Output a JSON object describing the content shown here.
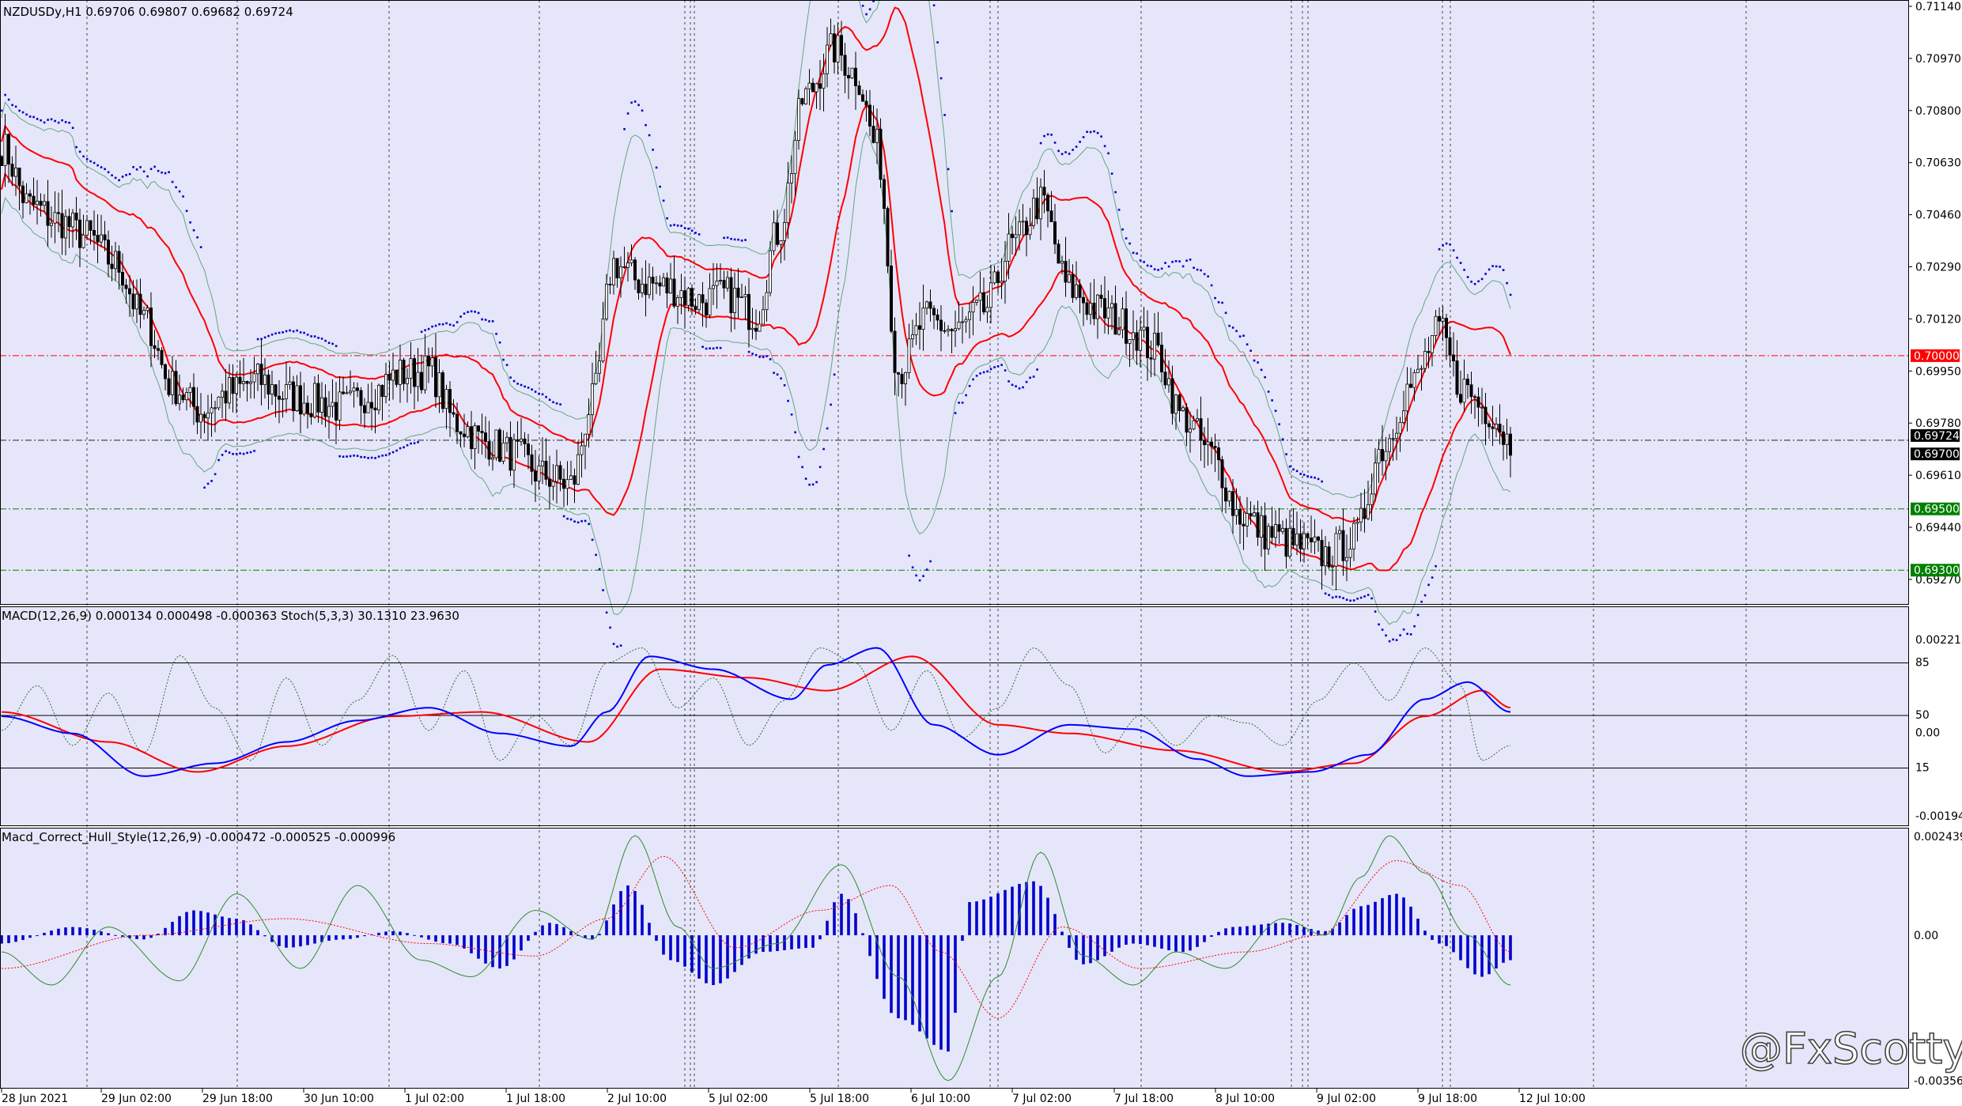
{
  "colors": {
    "background": "#E6E6FA",
    "candle": "#000000",
    "bollinger_mid": "#FF0000",
    "bollinger_outer": "#5FA882",
    "parabolic_sar": "#0000CD",
    "macd_main": "#0000FF",
    "macd_signal": "#FF0000",
    "stoch_dotted": "#2E6B2E",
    "hist": "#0000CD",
    "level_red": "#FF0000",
    "level_green": "#008000"
  },
  "main_panel": {
    "header": "NZDUSDy,H1  0.69706 0.69807 0.69682 0.69724",
    "price_labels": [
      "0.71140",
      "0.70970",
      "0.70800",
      "0.70630",
      "0.70460",
      "0.70290",
      "0.70120",
      "0.69950",
      "0.69780",
      "0.69610",
      "0.69440",
      "0.69270"
    ],
    "level_tags": [
      {
        "label": "0.70000",
        "value": 0.7,
        "color": "#FF0000"
      },
      {
        "label": "0.69500",
        "value": 0.695,
        "color": "#008000"
      },
      {
        "label": "0.69300",
        "value": 0.693,
        "color": "#008000"
      },
      {
        "label": "0.69724",
        "value": 0.69724,
        "color": "#000000"
      },
      {
        "label": "0.69700",
        "value": 0.697,
        "color": "#000000"
      }
    ]
  },
  "macd_panel": {
    "header": "MACD(12,26,9) 0.000134 0.000498 -0.000363  Stoch(5,3,3) 30.1310 23.9630",
    "axis_labels": [
      "0.002212",
      "85",
      "50",
      "0.00",
      "15",
      "-0.001947"
    ]
  },
  "hull_panel": {
    "header": "Macd_Correct_Hull_Style(12,26,9) -0.000472 -0.000525 -0.000996",
    "axis_labels": [
      "0.002439",
      "0.00",
      "-0.003561"
    ]
  },
  "time_labels": [
    "28 Jun 2021",
    "29 Jun 02:00",
    "29 Jun 18:00",
    "30 Jun 10:00",
    "1 Jul 02:00",
    "1 Jul 18:00",
    "2 Jul 10:00",
    "5 Jul 02:00",
    "5 Jul 18:00",
    "6 Jul 10:00",
    "7 Jul 02:00",
    "7 Jul 18:00",
    "8 Jul 10:00",
    "9 Jul 02:00",
    "9 Jul 18:00",
    "12 Jul 10:00"
  ],
  "watermark": "@FxScotty",
  "chart_data": {
    "type": "line",
    "title": "NZDUSDy,H1",
    "ylim": [
      0.692,
      0.7114
    ],
    "price_anchors": [
      [
        0,
        0.7068
      ],
      [
        8,
        0.7049
      ],
      [
        16,
        0.7044
      ],
      [
        24,
        0.7039
      ],
      [
        32,
        0.703
      ],
      [
        40,
        0.7012
      ],
      [
        48,
        0.699
      ],
      [
        56,
        0.6982
      ],
      [
        64,
        0.6988
      ],
      [
        72,
        0.6992
      ],
      [
        80,
        0.6987
      ],
      [
        88,
        0.6985
      ],
      [
        96,
        0.6983
      ],
      [
        104,
        0.6988
      ],
      [
        112,
        0.6994
      ],
      [
        120,
        0.6995
      ],
      [
        128,
        0.6978
      ],
      [
        136,
        0.6972
      ],
      [
        144,
        0.6968
      ],
      [
        152,
        0.6961
      ],
      [
        160,
        0.6958
      ],
      [
        166,
        0.6985
      ],
      [
        172,
        0.703
      ],
      [
        180,
        0.7024
      ],
      [
        188,
        0.7022
      ],
      [
        196,
        0.7018
      ],
      [
        204,
        0.702
      ],
      [
        212,
        0.7013
      ],
      [
        218,
        0.704
      ],
      [
        226,
        0.7085
      ],
      [
        234,
        0.71
      ],
      [
        240,
        0.7092
      ],
      [
        246,
        0.7068
      ],
      [
        252,
        0.6995
      ],
      [
        260,
        0.7012
      ],
      [
        268,
        0.7008
      ],
      [
        276,
        0.7015
      ],
      [
        284,
        0.7036
      ],
      [
        292,
        0.705
      ],
      [
        300,
        0.7022
      ],
      [
        308,
        0.7015
      ],
      [
        316,
        0.701
      ],
      [
        324,
        0.7002
      ],
      [
        332,
        0.698
      ],
      [
        340,
        0.6968
      ],
      [
        348,
        0.6948
      ],
      [
        356,
        0.6942
      ],
      [
        364,
        0.6938
      ],
      [
        372,
        0.6935
      ],
      [
        380,
        0.694
      ],
      [
        388,
        0.697
      ],
      [
        396,
        0.699
      ],
      [
        404,
        0.7008
      ],
      [
        410,
        0.699
      ],
      [
        418,
        0.6982
      ],
      [
        424,
        0.6972
      ]
    ],
    "macd_anchors": [
      [
        0,
        0.0004
      ],
      [
        20,
        0.0
      ],
      [
        40,
        -0.001
      ],
      [
        60,
        -0.0007
      ],
      [
        80,
        -0.0002
      ],
      [
        100,
        0.0003
      ],
      [
        120,
        0.0006
      ],
      [
        140,
        0.0
      ],
      [
        160,
        -0.0003
      ],
      [
        170,
        0.0005
      ],
      [
        182,
        0.0018
      ],
      [
        200,
        0.0015
      ],
      [
        222,
        0.0008
      ],
      [
        232,
        0.0016
      ],
      [
        246,
        0.002
      ],
      [
        262,
        0.0002
      ],
      [
        280,
        -0.0005
      ],
      [
        300,
        0.0002
      ],
      [
        318,
        0.0001
      ],
      [
        336,
        -0.0006
      ],
      [
        350,
        -0.001
      ],
      [
        368,
        -0.0009
      ],
      [
        384,
        -0.0005
      ],
      [
        400,
        0.0008
      ],
      [
        412,
        0.0012
      ],
      [
        424,
        0.0005
      ]
    ],
    "signal_anchors": [
      [
        0,
        0.0005
      ],
      [
        30,
        -0.0002
      ],
      [
        55,
        -0.0009
      ],
      [
        80,
        -0.0003
      ],
      [
        110,
        0.0004
      ],
      [
        135,
        0.0005
      ],
      [
        165,
        -0.0002
      ],
      [
        185,
        0.0015
      ],
      [
        210,
        0.0013
      ],
      [
        232,
        0.001
      ],
      [
        256,
        0.0018
      ],
      [
        280,
        0.0002
      ],
      [
        300,
        0.0
      ],
      [
        330,
        -0.0004
      ],
      [
        360,
        -0.0009
      ],
      [
        380,
        -0.0007
      ],
      [
        400,
        0.0004
      ],
      [
        416,
        0.001
      ],
      [
        424,
        0.0006
      ]
    ],
    "stoch_anchors": [
      [
        0,
        40
      ],
      [
        10,
        70
      ],
      [
        20,
        30
      ],
      [
        30,
        65
      ],
      [
        40,
        25
      ],
      [
        50,
        90
      ],
      [
        60,
        55
      ],
      [
        70,
        20
      ],
      [
        80,
        75
      ],
      [
        90,
        30
      ],
      [
        100,
        60
      ],
      [
        110,
        90
      ],
      [
        120,
        40
      ],
      [
        130,
        80
      ],
      [
        140,
        20
      ],
      [
        150,
        50
      ],
      [
        160,
        30
      ],
      [
        170,
        85
      ],
      [
        180,
        95
      ],
      [
        190,
        55
      ],
      [
        200,
        75
      ],
      [
        210,
        30
      ],
      [
        220,
        60
      ],
      [
        230,
        95
      ],
      [
        240,
        85
      ],
      [
        250,
        40
      ],
      [
        260,
        80
      ],
      [
        270,
        35
      ],
      [
        280,
        55
      ],
      [
        290,
        95
      ],
      [
        300,
        70
      ],
      [
        310,
        25
      ],
      [
        320,
        50
      ],
      [
        330,
        30
      ],
      [
        340,
        50
      ],
      [
        350,
        45
      ],
      [
        360,
        30
      ],
      [
        370,
        60
      ],
      [
        380,
        85
      ],
      [
        390,
        60
      ],
      [
        400,
        95
      ],
      [
        410,
        70
      ],
      [
        416,
        20
      ],
      [
        424,
        30
      ]
    ],
    "hist_anchors": [
      [
        0,
        -0.0002
      ],
      [
        20,
        0.0002
      ],
      [
        40,
        -0.0001
      ],
      [
        54,
        0.0006
      ],
      [
        66,
        0.0004
      ],
      [
        80,
        -0.0003
      ],
      [
        96,
        -0.0001
      ],
      [
        110,
        0.0001
      ],
      [
        126,
        -0.0002
      ],
      [
        140,
        -0.0008
      ],
      [
        154,
        0.0003
      ],
      [
        166,
        -0.0001
      ],
      [
        176,
        0.0012
      ],
      [
        188,
        -0.0006
      ],
      [
        200,
        -0.0012
      ],
      [
        214,
        -0.0004
      ],
      [
        228,
        -0.0003
      ],
      [
        236,
        0.001
      ],
      [
        252,
        -0.002
      ],
      [
        266,
        -0.0028
      ],
      [
        272,
        0.0008
      ],
      [
        290,
        0.0013
      ],
      [
        304,
        -0.0007
      ],
      [
        318,
        -0.0002
      ],
      [
        332,
        -0.0004
      ],
      [
        346,
        0.0002
      ],
      [
        360,
        0.0003
      ],
      [
        372,
        0.0001
      ],
      [
        382,
        0.0007
      ],
      [
        392,
        0.001
      ],
      [
        404,
        -0.0002
      ],
      [
        416,
        -0.001
      ],
      [
        424,
        -0.0006
      ]
    ],
    "hull_line_anchors": [
      [
        0,
        -0.0004
      ],
      [
        14,
        -0.0012
      ],
      [
        30,
        0.0002
      ],
      [
        50,
        -0.0011
      ],
      [
        66,
        0.001
      ],
      [
        84,
        -0.0008
      ],
      [
        100,
        0.0012
      ],
      [
        118,
        -0.0006
      ],
      [
        132,
        -0.001
      ],
      [
        150,
        0.0006
      ],
      [
        166,
        -0.0001
      ],
      [
        178,
        0.0024
      ],
      [
        190,
        0.0002
      ],
      [
        200,
        -0.0008
      ],
      [
        218,
        -0.0002
      ],
      [
        236,
        0.0017
      ],
      [
        252,
        -0.001
      ],
      [
        266,
        -0.0035
      ],
      [
        280,
        -0.001
      ],
      [
        292,
        0.002
      ],
      [
        304,
        -0.0005
      ],
      [
        318,
        -0.0012
      ],
      [
        330,
        -0.0004
      ],
      [
        344,
        -0.0008
      ],
      [
        360,
        0.0004
      ],
      [
        372,
        0.0
      ],
      [
        382,
        0.0014
      ],
      [
        390,
        0.0024
      ],
      [
        400,
        0.0015
      ],
      [
        412,
        0.0
      ],
      [
        424,
        -0.0012
      ]
    ],
    "hull_sig_anchors": [
      [
        0,
        -0.0008
      ],
      [
        40,
        0.0
      ],
      [
        80,
        0.0004
      ],
      [
        120,
        -0.0002
      ],
      [
        150,
        -0.0005
      ],
      [
        170,
        0.0004
      ],
      [
        186,
        0.0019
      ],
      [
        206,
        -0.0003
      ],
      [
        230,
        0.0006
      ],
      [
        250,
        0.0012
      ],
      [
        264,
        -0.0004
      ],
      [
        280,
        -0.002
      ],
      [
        298,
        0.0002
      ],
      [
        320,
        -0.0008
      ],
      [
        350,
        -0.0004
      ],
      [
        370,
        0.0
      ],
      [
        392,
        0.0018
      ],
      [
        410,
        0.0012
      ],
      [
        424,
        -0.0004
      ]
    ]
  }
}
